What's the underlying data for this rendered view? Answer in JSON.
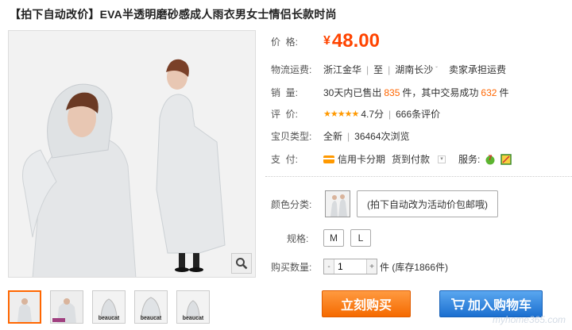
{
  "product": {
    "title": "【拍下自动改价】EVA半透明磨砂感成人雨衣男女士情侣长款时尚"
  },
  "price": {
    "label": "价  格:",
    "currency": "¥",
    "value": "48.00"
  },
  "shipping": {
    "label": "物流运费:",
    "origin": "浙江金华",
    "to": "至",
    "destination": "湖南长沙",
    "fee": "卖家承担运费"
  },
  "sales": {
    "label": "销  量:",
    "prefix": "30天内已售出",
    "sold": "835",
    "mid": "件，其中交易成功",
    "success": "632",
    "suffix": "件"
  },
  "rating": {
    "label": "评  价:",
    "stars": "★★★★★",
    "score": "4.7分",
    "reviews": "666条评价"
  },
  "type": {
    "label": "宝贝类型:",
    "condition": "全新",
    "views": "36464次浏览"
  },
  "payment": {
    "label": "支  付:",
    "credit": "信用卡分期",
    "cod": "货到付款",
    "service_label": "服务:"
  },
  "color": {
    "label": "颜色分类:",
    "option": "(拍下自动改为活动价包邮哦)"
  },
  "size": {
    "label": "规格:",
    "options": [
      "M",
      "L"
    ]
  },
  "quantity": {
    "label": "购买数量:",
    "value": "1",
    "stock": "件 (库存1866件)"
  },
  "actions": {
    "buy": "立刻购买",
    "cart": "加入购物车"
  },
  "thumbnails": {
    "labels": [
      "",
      "",
      "beaucat",
      "beaucat",
      "beaucat"
    ]
  },
  "watermark": "myhome365.com"
}
